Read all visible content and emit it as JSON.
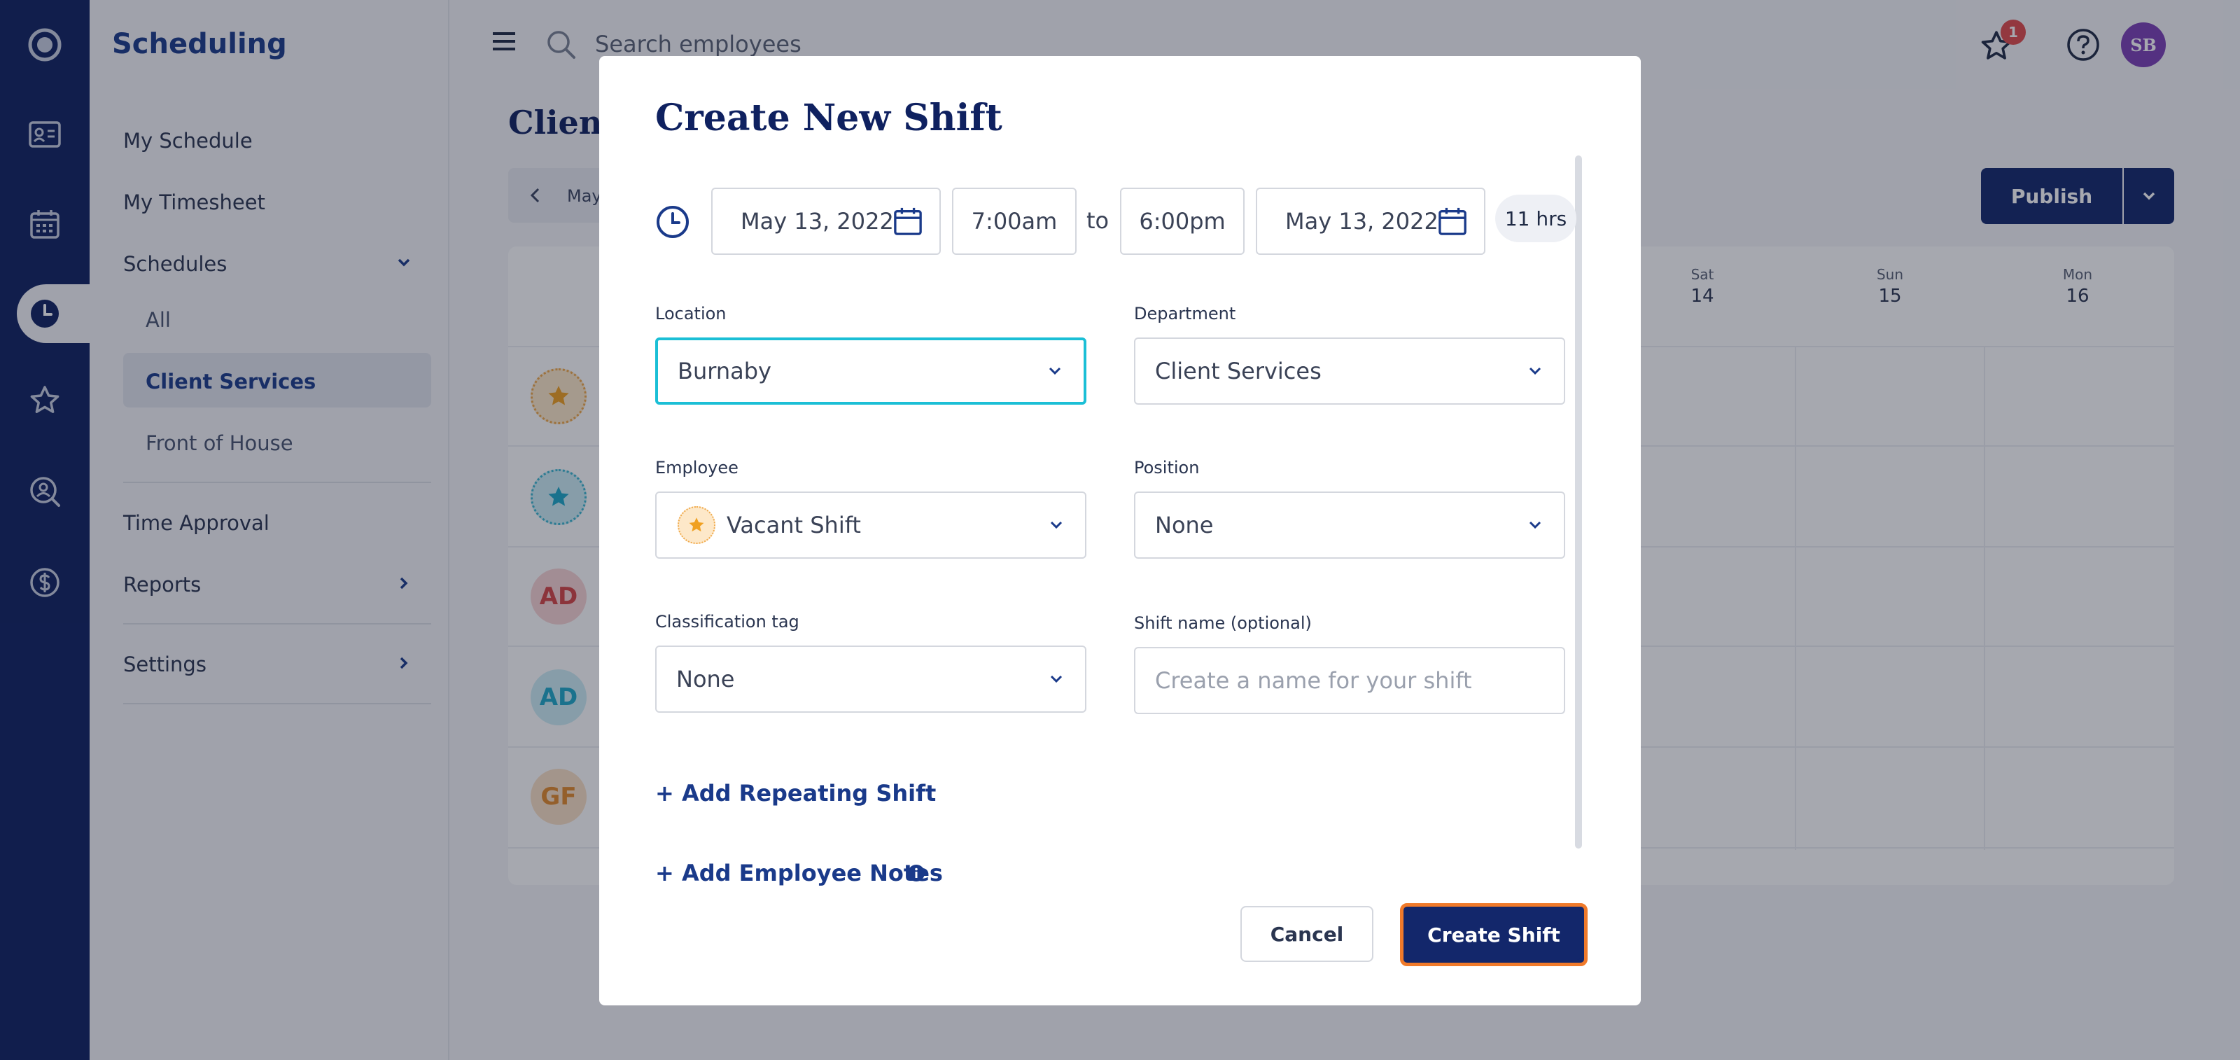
{
  "sidebar": {
    "title": "Scheduling",
    "items": [
      {
        "label": "My Schedule"
      },
      {
        "label": "My Timesheet"
      },
      {
        "label": "Schedules"
      },
      {
        "label": "All"
      },
      {
        "label": "Client Services"
      },
      {
        "label": "Front of House"
      },
      {
        "label": "Time Approval"
      },
      {
        "label": "Reports"
      },
      {
        "label": "Settings"
      }
    ]
  },
  "topbar": {
    "search_placeholder": "Search employees",
    "notification_count": "1",
    "user_initials": "SB"
  },
  "page": {
    "title": "Client",
    "date_range": "May",
    "publish_label": "Publish",
    "days": [
      {
        "name": "Sat",
        "num": "14"
      },
      {
        "name": "Sun",
        "num": "15"
      },
      {
        "name": "Mon",
        "num": "16"
      }
    ],
    "rows": [
      {
        "initials": ""
      },
      {
        "initials": ""
      },
      {
        "initials": "AD"
      },
      {
        "initials": "AD"
      },
      {
        "initials": "GF"
      }
    ]
  },
  "modal": {
    "title": "Create New Shift",
    "start_date": "May 13, 2022",
    "start_time": "7:00am",
    "to_label": "to",
    "end_time": "6:00pm",
    "end_date": "May 13, 2022",
    "duration": "11 hrs",
    "location_label": "Location",
    "location_value": "Burnaby",
    "department_label": "Department",
    "department_value": "Client Services",
    "employee_label": "Employee",
    "employee_value": "Vacant Shift",
    "position_label": "Position",
    "position_value": "None",
    "classification_label": "Classification tag",
    "classification_value": "None",
    "shift_name_label": "Shift name (optional)",
    "shift_name_placeholder": "Create a name for your shift",
    "add_repeating": "+ Add Repeating Shift",
    "add_notes": "+ Add Employee Notes",
    "cancel_label": "Cancel",
    "create_label": "Create Shift"
  },
  "colors": {
    "brand": "#0f2160",
    "accent_focus": "#1bbfd6",
    "highlight": "#f07a2a"
  }
}
